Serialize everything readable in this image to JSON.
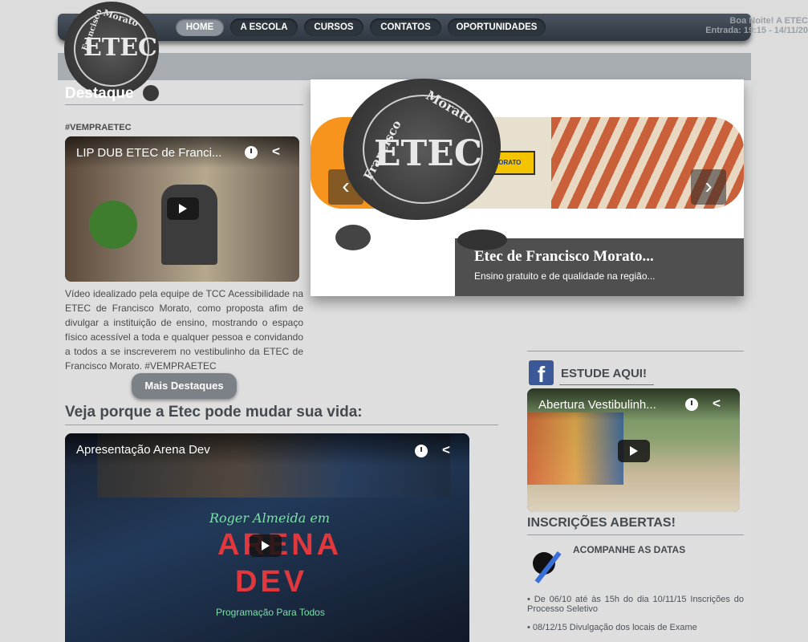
{
  "nav": {
    "items": [
      {
        "label": "HOME",
        "active": true
      },
      {
        "label": "A ESCOLA",
        "active": false
      },
      {
        "label": "CURSOS",
        "active": false
      },
      {
        "label": "CONTATOS",
        "active": false
      },
      {
        "label": "OPORTUNIDADES",
        "active": false
      }
    ],
    "greeting_line1": "Boa Noite! A ETEC",
    "greeting_line2": "Entrada: 19:15 - 14/11/20"
  },
  "logo": {
    "top_text": "Morato",
    "center_text": "ETEC",
    "bottom_text": "Francisco"
  },
  "destaque": {
    "heading": "Destaque",
    "tag": "#VEMPRAETEC",
    "video_title": "LIP DUB ETEC de Franci...",
    "description": "Vídeo idealizado pela equipe de TCC Acessibilidade na ETEC de Francisco Morato, como proposta afim de divulgar a instituição de ensino, mostrando o espaço físico acessível a toda e qualquer pessoa e convidando a todos a se inscreverem no vestibulinho da ETEC de Francisco Morato. #VEMPRAETEC",
    "more_button": "Mais Destaques"
  },
  "slider": {
    "caption_title": "Etec de Francisco Morato...",
    "caption_sub": "Ensino gratuito e de qualidade na região...",
    "sign_text": "MORATO",
    "prev_icon": "‹",
    "next_icon": "›"
  },
  "why": {
    "heading": "Veja porque a Etec pode mudar sua vida:",
    "video_title": "Apresentação Arena Dev",
    "overlay_line1": "Roger Almeida em",
    "overlay_line2": "ARENA",
    "overlay_line3": "DEV",
    "overlay_line4": "Programação Para Todos"
  },
  "sidebar": {
    "study_heading": "ESTUDE AQUI!",
    "video_title": "Abertura Vestibulinh...",
    "inscricoes_heading": "INSCRIÇÕES ABERTAS!",
    "acompanhe": "ACOMPANHE AS DATAS",
    "dates": [
      "De 06/10 até às 15h do dia 10/11/15 Inscrições do Processo Seletivo",
      "08/12/15 Divulgação dos locais de Exame"
    ]
  },
  "icons": {
    "facebook": "f",
    "bullet": "•"
  },
  "colors": {
    "nav_bg": "#3a434c",
    "active_tab": "#8d949c",
    "caption_bg": "#4f4f4f",
    "slider_orange": "#f7941d",
    "facebook_blue": "#3b5998"
  }
}
